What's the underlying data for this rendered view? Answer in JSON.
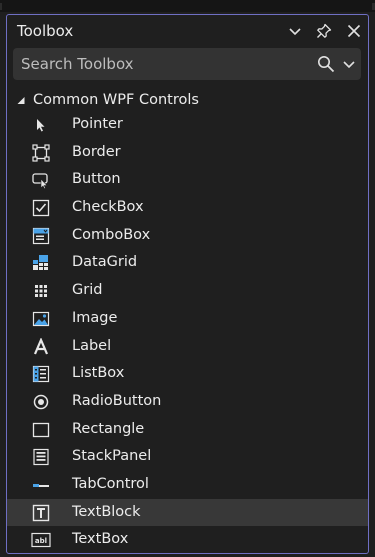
{
  "panel": {
    "title": "Toolbox",
    "search_placeholder": "Search Toolbox",
    "group_label": "Common WPF Controls"
  },
  "items": [
    {
      "label": "Pointer",
      "icon": "pointer-icon"
    },
    {
      "label": "Border",
      "icon": "border-icon"
    },
    {
      "label": "Button",
      "icon": "button-icon"
    },
    {
      "label": "CheckBox",
      "icon": "checkbox-icon"
    },
    {
      "label": "ComboBox",
      "icon": "combobox-icon"
    },
    {
      "label": "DataGrid",
      "icon": "datagrid-icon"
    },
    {
      "label": "Grid",
      "icon": "grid-icon"
    },
    {
      "label": "Image",
      "icon": "image-icon"
    },
    {
      "label": "Label",
      "icon": "label-icon"
    },
    {
      "label": "ListBox",
      "icon": "listbox-icon"
    },
    {
      "label": "RadioButton",
      "icon": "radiobutton-icon"
    },
    {
      "label": "Rectangle",
      "icon": "rectangle-icon"
    },
    {
      "label": "StackPanel",
      "icon": "stackpanel-icon"
    },
    {
      "label": "TabControl",
      "icon": "tabcontrol-icon"
    },
    {
      "label": "TextBlock",
      "icon": "textblock-icon",
      "selected": true
    },
    {
      "label": "TextBox",
      "icon": "textbox-icon"
    }
  ],
  "colors": {
    "panel_border": "#6f6fc4",
    "background": "#1f1f1f",
    "search_bg": "#333333",
    "selected_bg": "#383838",
    "icon_blue": "#4aa3e8"
  }
}
